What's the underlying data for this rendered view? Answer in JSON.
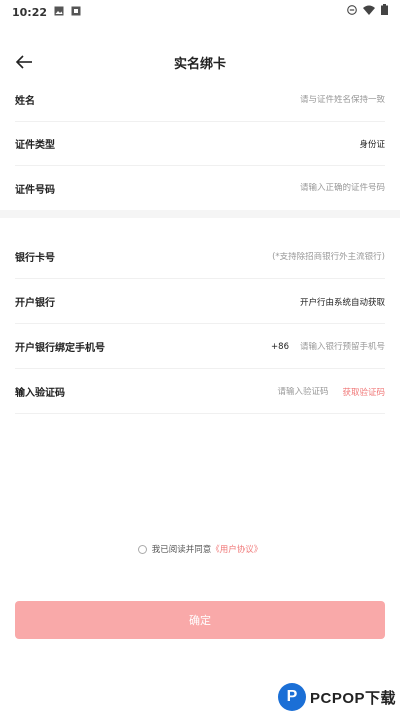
{
  "status_bar": {
    "time": "10:22"
  },
  "header": {
    "title": "实名绑卡"
  },
  "form": {
    "name": {
      "label": "姓名",
      "placeholder": "请与证件姓名保持一致"
    },
    "id_type": {
      "label": "证件类型",
      "value": "身份证"
    },
    "id_number": {
      "label": "证件号码",
      "placeholder": "请输入正确的证件号码"
    },
    "bank_card": {
      "label": "银行卡号",
      "placeholder": "(*支持除招商银行外主流银行)"
    },
    "bank": {
      "label": "开户银行",
      "value": "开户行由系统自动获取"
    },
    "phone": {
      "label": "开户银行绑定手机号",
      "prefix": "+86",
      "placeholder": "请输入银行预留手机号"
    },
    "code": {
      "label": "输入验证码",
      "placeholder": "请输入验证码",
      "button": "获取验证码"
    }
  },
  "agreement": {
    "text": "我已阅读并同意",
    "link": "《用户协议》"
  },
  "confirm_label": "确定",
  "watermark": {
    "logo_letter": "P",
    "text": "PCPOP下载"
  },
  "colors": {
    "accent": "#f07878",
    "button_bg": "#f9a9a9",
    "divider": "#f5f5f5"
  }
}
